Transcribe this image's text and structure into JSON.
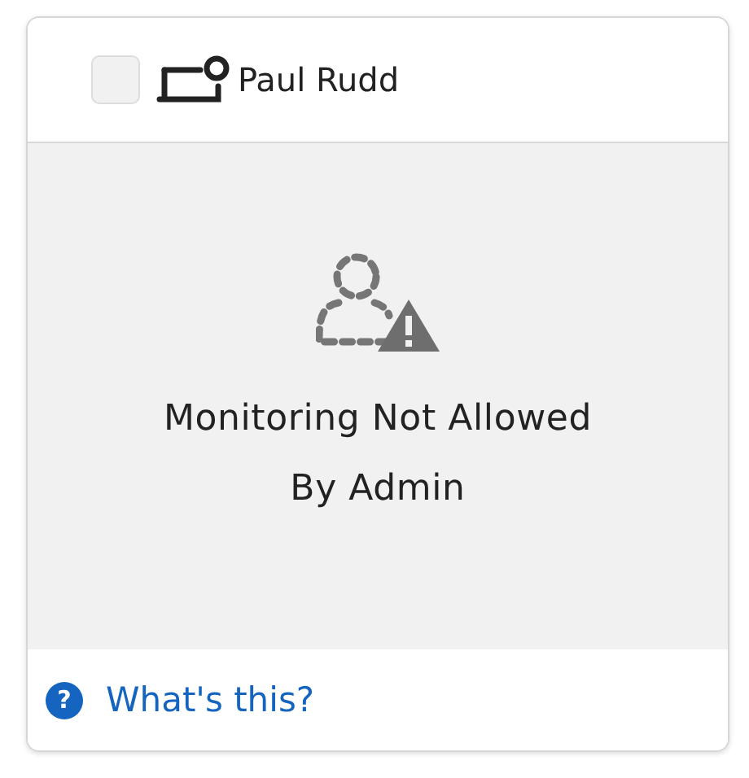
{
  "device": {
    "name": "Paul Rudd",
    "checked": false
  },
  "status": {
    "lines": [
      "Monitoring Not Allowed",
      "By Admin"
    ]
  },
  "help": {
    "icon": "?",
    "link": "What's this?"
  }
}
